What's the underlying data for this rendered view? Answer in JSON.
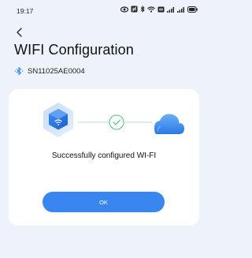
{
  "status_bar": {
    "time": "19:17",
    "icons": [
      "eye-icon",
      "nfc-icon",
      "bluetooth-icon",
      "wifi-icon",
      "hd-icon",
      "signal-icon",
      "signal-icon",
      "battery-icon"
    ]
  },
  "header": {
    "back_icon": "chevron-left-icon",
    "title": "WIFI Configuration"
  },
  "device": {
    "icon": "bluetooth-icon",
    "serial": "SN11025AE0004"
  },
  "result_card": {
    "illustration": [
      "router-icon",
      "check-icon",
      "cloud-icon"
    ],
    "message": "Successfully configured WI-FI",
    "ok_label": "OK"
  },
  "colors": {
    "accent": "#3a86f0",
    "background": "#eef3fb",
    "card": "#ffffff",
    "success": "#4cc472"
  }
}
